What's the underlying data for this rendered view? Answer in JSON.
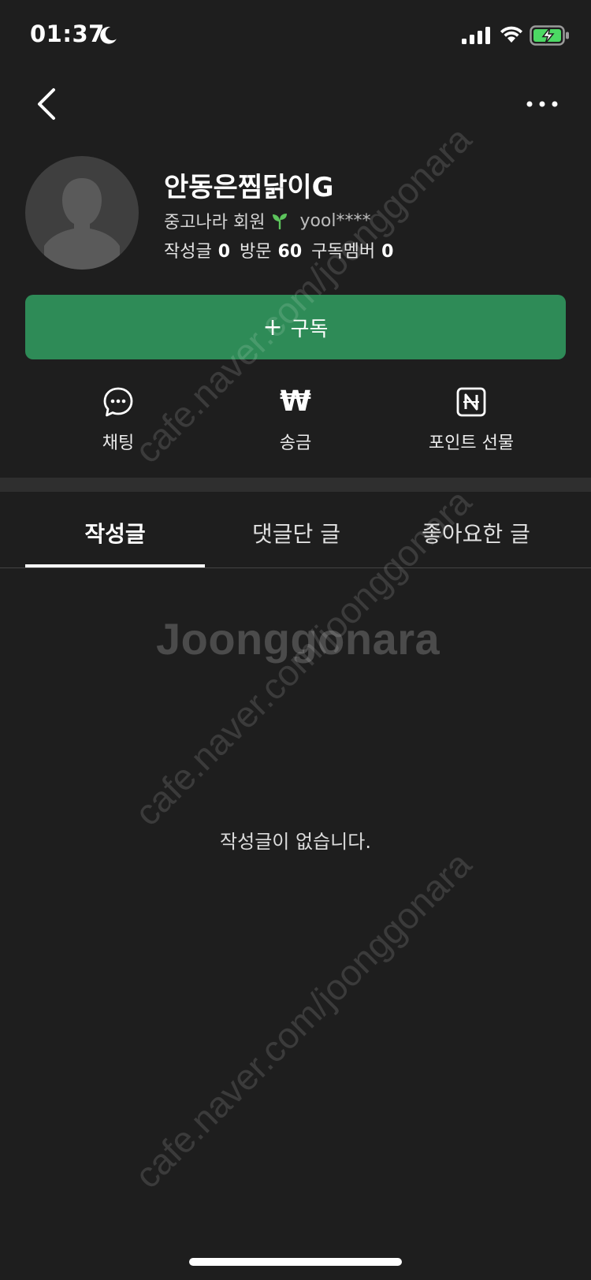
{
  "status_bar": {
    "time": "01:37"
  },
  "profile": {
    "name": "안동은찜닭이G",
    "member_level": "중고나라 회원",
    "member_id": "yool****",
    "stats": [
      {
        "label": "작성글",
        "value": "0"
      },
      {
        "label": "방문",
        "value": "60"
      },
      {
        "label": "구독멤버",
        "value": "0"
      }
    ]
  },
  "subscribe_button": {
    "plus": "+",
    "label": "구독"
  },
  "actions": {
    "chat": {
      "label": "채팅",
      "icon": "chat-bubble-icon"
    },
    "transfer": {
      "label": "송금",
      "icon": "won-icon",
      "glyph": "₩"
    },
    "gift": {
      "label": "포인트 선물",
      "icon": "naver-point-icon"
    }
  },
  "tabs": [
    {
      "label": "작성글",
      "active": true
    },
    {
      "label": "댓글단 글",
      "active": false
    },
    {
      "label": "좋아요한 글",
      "active": false
    }
  ],
  "empty_message": "작성글이 없습니다.",
  "watermark": {
    "url": "cafe.naver.com/joonggonara",
    "logo": "Joonggonara"
  },
  "colors": {
    "background": "#1e1e1e",
    "accent": "#2e8b57",
    "sprout": "#5cc45c"
  }
}
